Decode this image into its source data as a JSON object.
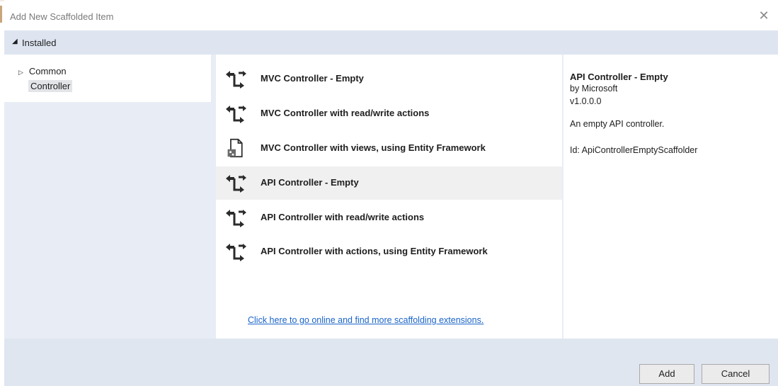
{
  "dialog": {
    "title": "Add New Scaffolded Item",
    "close_glyph": "✕"
  },
  "installed": {
    "label": "Installed",
    "icon": "triangle-down-icon"
  },
  "tree": {
    "items": [
      {
        "label": "Common",
        "icon": "triangle-right-icon"
      },
      {
        "label": "Controller",
        "selected": true
      }
    ]
  },
  "templates": {
    "items": [
      {
        "label": "MVC Controller - Empty",
        "icon": "controller-icon"
      },
      {
        "label": "MVC Controller with read/write actions",
        "icon": "controller-icon"
      },
      {
        "label": "MVC Controller with views, using Entity Framework",
        "icon": "document-controller-icon"
      },
      {
        "label": "API Controller - Empty",
        "icon": "controller-icon",
        "selected": true
      },
      {
        "label": "API Controller with read/write actions",
        "icon": "controller-icon"
      },
      {
        "label": "API Controller with actions, using Entity Framework",
        "icon": "controller-icon"
      }
    ],
    "online_link": "Click here to go online and find more scaffolding extensions."
  },
  "details": {
    "title": "API Controller - Empty",
    "author": "by Microsoft",
    "version": "v1.0.0.0",
    "description": "An empty API controller.",
    "id_text": "Id: ApiControllerEmptyScaffolder"
  },
  "footer": {
    "add_label": "Add",
    "cancel_label": "Cancel"
  },
  "colors": {
    "band": "#dee5f1",
    "selected": "#f0f0f0",
    "link": "#1a64c8"
  }
}
